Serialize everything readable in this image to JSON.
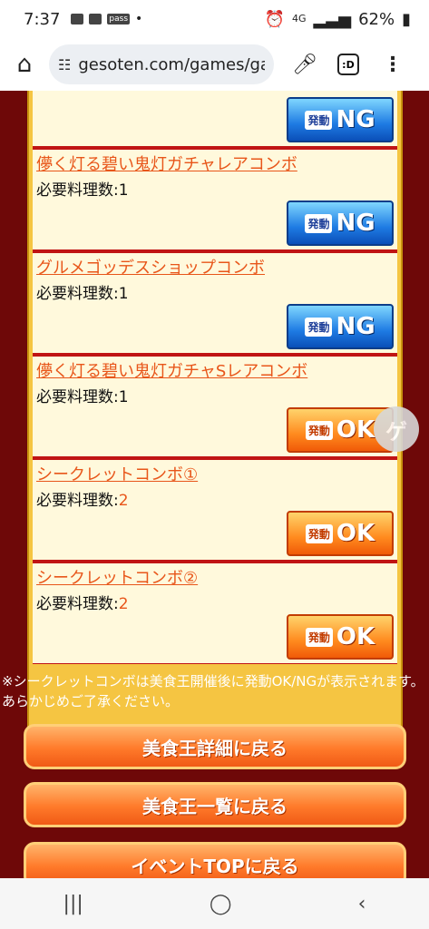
{
  "status": {
    "time": "7:37",
    "pass_label": "pass",
    "dot": "•",
    "network": "4G",
    "battery": "62%"
  },
  "browser": {
    "url": "gesoten.com/games/gai",
    "tab_label": ":D"
  },
  "combos": [
    {
      "name": "",
      "req_label": "",
      "req_value": "",
      "badge": "NG"
    },
    {
      "name": "儚く灯る碧い鬼灯ガチャレアコンボ",
      "req_label": "必要料理数:",
      "req_value": "1",
      "badge": "NG"
    },
    {
      "name": "グルメゴッデスショップコンボ",
      "req_label": "必要料理数:",
      "req_value": "1",
      "badge": "NG"
    },
    {
      "name": "儚く灯る碧い鬼灯ガチャSレアコンボ",
      "req_label": "必要料理数:",
      "req_value": "1",
      "badge": "OK"
    },
    {
      "name": "シークレットコンボ①",
      "req_label": "必要料理数:",
      "req_value": "2",
      "badge": "OK"
    },
    {
      "name": "シークレットコンボ②",
      "req_label": "必要料理数:",
      "req_value": "2",
      "badge": "OK"
    }
  ],
  "badge_prefix": "発動",
  "notice": "※シークレットコンボは美食王開催後に発動OK/NGが表示されます。あらかじめご了承ください。",
  "buttons": {
    "detail": "美食王詳細に戻る",
    "list": "美食王一覧に戻る",
    "event_top": "イベントTOPに戻る"
  },
  "colors": {
    "background": "#6e0808",
    "combo_name": "#e8561a",
    "button": "#ff7a2a"
  }
}
